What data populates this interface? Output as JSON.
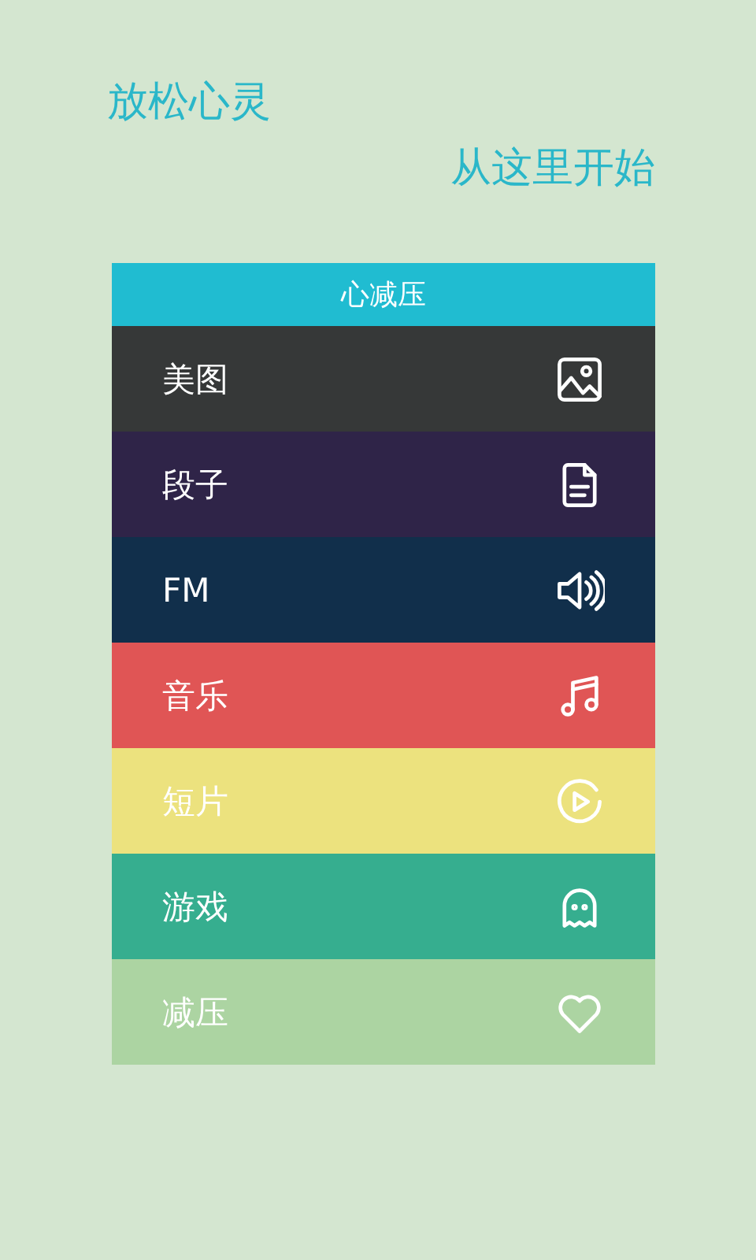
{
  "taglines": [
    "放松心灵",
    "从这里开始"
  ],
  "menu": {
    "title": "心减压",
    "items": [
      {
        "label": "美图",
        "kind": "image",
        "color": "#363838"
      },
      {
        "label": "段子",
        "kind": "document",
        "color": "#2f2448"
      },
      {
        "label": "FM",
        "kind": "speaker",
        "color": "#112f4b"
      },
      {
        "label": "音乐",
        "kind": "music",
        "color": "#e05555"
      },
      {
        "label": "短片",
        "kind": "play",
        "color": "#ece27e"
      },
      {
        "label": "游戏",
        "kind": "ghost",
        "color": "#36ae8f"
      },
      {
        "label": "减压",
        "kind": "heart",
        "color": "#acd4a2"
      }
    ]
  }
}
